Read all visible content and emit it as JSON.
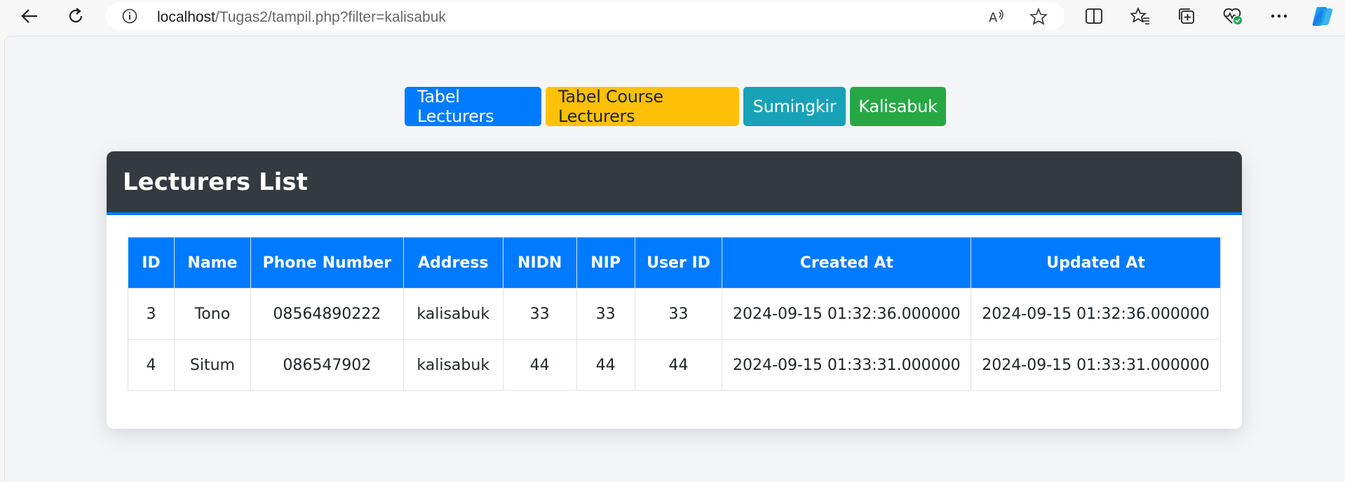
{
  "browser": {
    "url_host": "localhost",
    "url_path": "/Tugas2/tampil.php?filter=kalisabuk",
    "icons": [
      "back-icon",
      "refresh-icon",
      "info-icon",
      "read-aloud-icon",
      "favorite-star-icon",
      "split-screen-icon",
      "favorites-icon",
      "collections-icon",
      "browser-essentials-icon",
      "more-icon",
      "copilot-icon"
    ]
  },
  "nav_buttons": {
    "lecturers": "Tabel Lecturers",
    "course_lecturers": "Tabel Course Lecturers",
    "sumingkir": "Sumingkir",
    "kalisabuk": "Kalisabuk"
  },
  "colors": {
    "primary": "#007bff",
    "warning": "#ffc107",
    "info": "#17a2b8",
    "success": "#28a745",
    "header_dark": "#343a40"
  },
  "card": {
    "title": "Lecturers List"
  },
  "table": {
    "headers": [
      "ID",
      "Name",
      "Phone Number",
      "Address",
      "NIDN",
      "NIP",
      "User ID",
      "Created At",
      "Updated At"
    ],
    "rows": [
      [
        "3",
        "Tono",
        "08564890222",
        "kalisabuk",
        "33",
        "33",
        "33",
        "2024-09-15 01:32:36.000000",
        "2024-09-15 01:32:36.000000"
      ],
      [
        "4",
        "Situm",
        "086547902",
        "kalisabuk",
        "44",
        "44",
        "44",
        "2024-09-15 01:33:31.000000",
        "2024-09-15 01:33:31.000000"
      ]
    ]
  }
}
